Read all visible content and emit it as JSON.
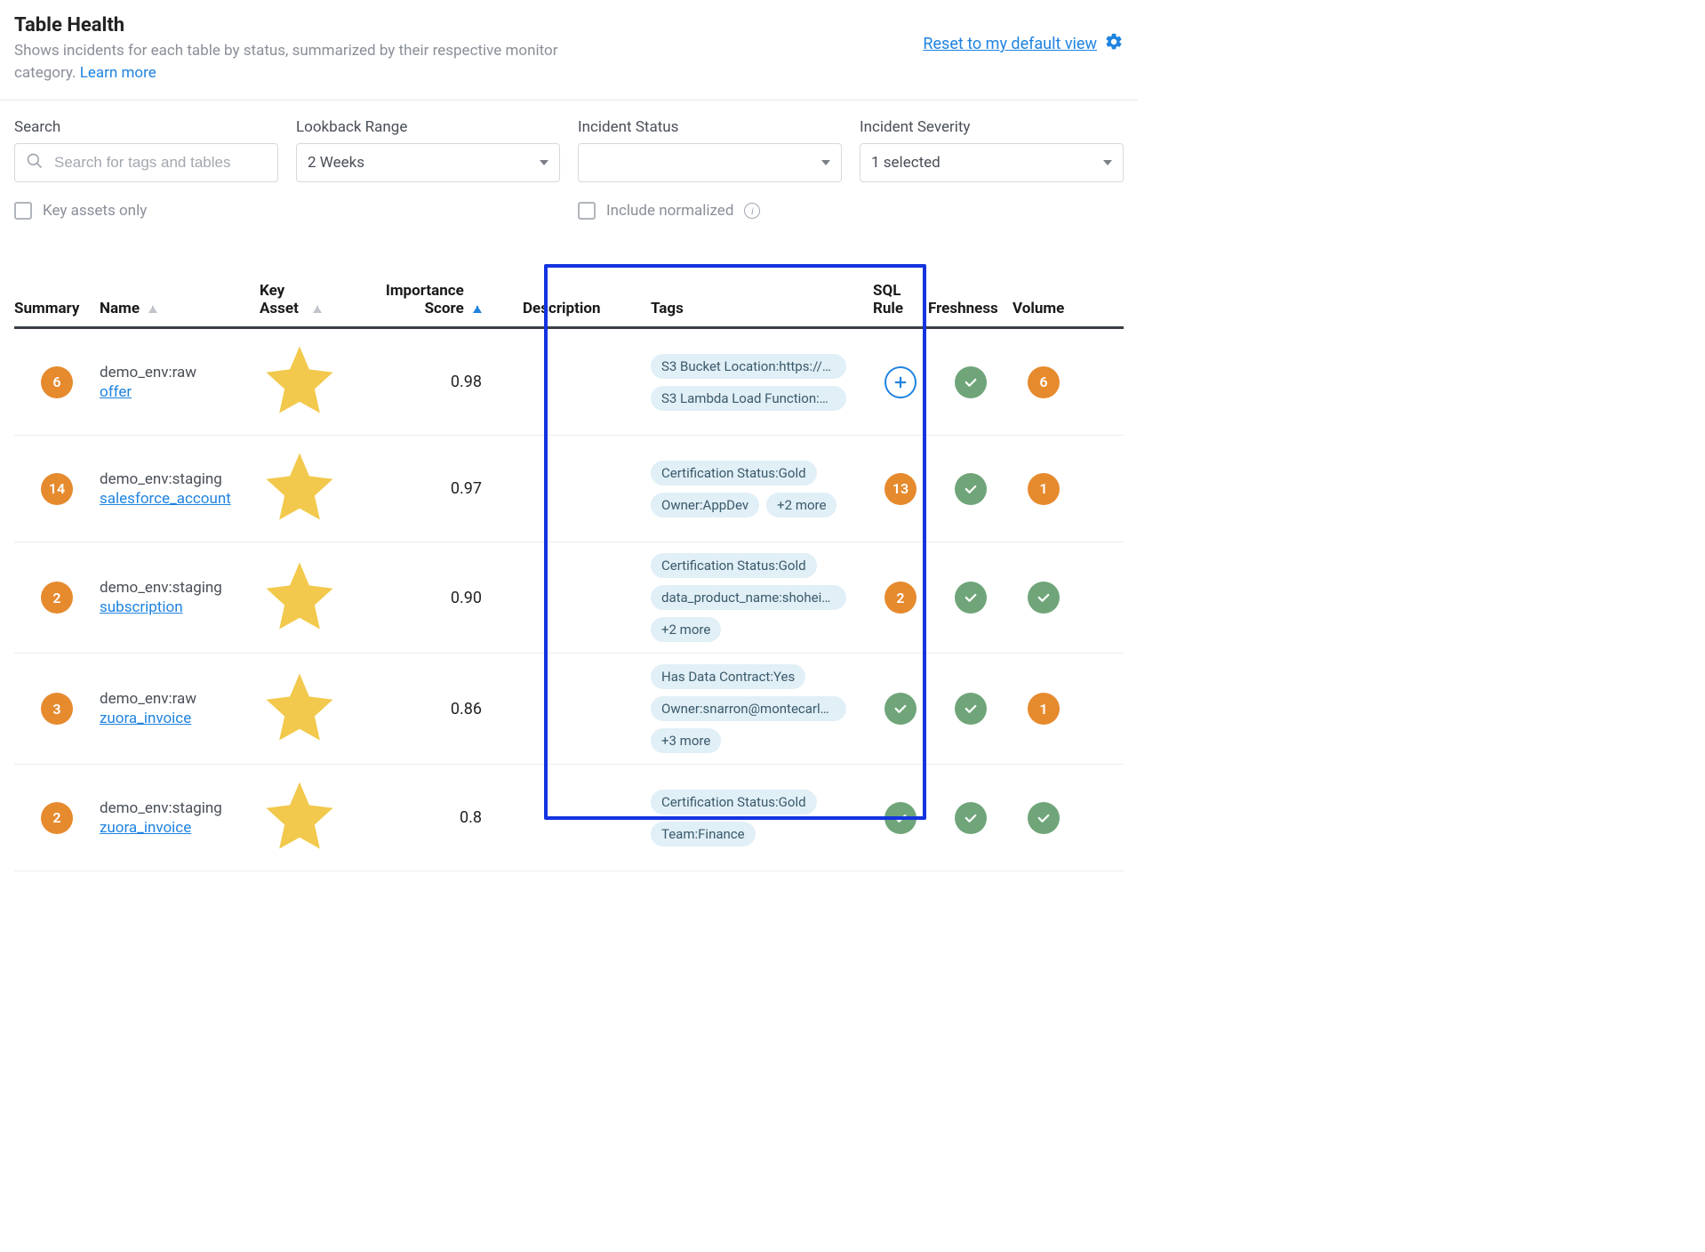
{
  "header": {
    "title": "Table Health",
    "subtitle_pre": "Shows incidents for each table by status, summarized by their respective monitor category. ",
    "learn_more": "Learn more",
    "reset_label": "Reset to my default view"
  },
  "filters": {
    "search": {
      "label": "Search",
      "placeholder": "Search for tags and tables"
    },
    "lookback": {
      "label": "Lookback Range",
      "value": "2 Weeks"
    },
    "status": {
      "label": "Incident Status",
      "value": ""
    },
    "severity": {
      "label": "Incident Severity",
      "value": "1 selected"
    },
    "key_assets_only": "Key assets only",
    "include_normalized": "Include normalized"
  },
  "columns": {
    "summary": "Summary",
    "name": "Name",
    "key_asset": "Key Asset",
    "importance": "Importance Score",
    "description": "Description",
    "tags": "Tags",
    "sql_rule": "SQL Rule",
    "freshness": "Freshness",
    "volume": "Volume"
  },
  "rows": [
    {
      "summary": {
        "type": "orange",
        "value": "6"
      },
      "env": "demo_env:raw",
      "name": "offer",
      "key_asset": true,
      "score": "0.98",
      "tags": [
        "S3 Bucket Location:https://s...",
        "S3 Lambda Load Function:ht..."
      ],
      "sql": {
        "type": "plus",
        "value": ""
      },
      "fresh": {
        "type": "green",
        "value": "check"
      },
      "vol": {
        "type": "orange",
        "value": "6"
      }
    },
    {
      "summary": {
        "type": "orange",
        "value": "14"
      },
      "env": "demo_env:staging",
      "name": "salesforce_account",
      "key_asset": true,
      "score": "0.97",
      "tags": [
        "Certification Status:Gold",
        "Owner:AppDev",
        "+2 more"
      ],
      "sql": {
        "type": "orange",
        "value": "13"
      },
      "fresh": {
        "type": "green",
        "value": "check"
      },
      "vol": {
        "type": "orange",
        "value": "1"
      }
    },
    {
      "summary": {
        "type": "orange",
        "value": "2"
      },
      "env": "demo_env:staging",
      "name": "subscription",
      "key_asset": true,
      "score": "0.90",
      "tags": [
        "Certification Status:Gold",
        "data_product_name:shohei_t...",
        "+2 more"
      ],
      "sql": {
        "type": "orange",
        "value": "2"
      },
      "fresh": {
        "type": "green",
        "value": "check"
      },
      "vol": {
        "type": "green",
        "value": "check"
      }
    },
    {
      "summary": {
        "type": "orange",
        "value": "3"
      },
      "env": "demo_env:raw",
      "name": "zuora_invoice",
      "key_asset": true,
      "score": "0.86",
      "tags": [
        "Has Data Contract:Yes",
        "Owner:snarron@montecarlo...",
        "+3 more"
      ],
      "sql": {
        "type": "green",
        "value": "check"
      },
      "fresh": {
        "type": "green",
        "value": "check"
      },
      "vol": {
        "type": "orange",
        "value": "1"
      }
    },
    {
      "summary": {
        "type": "orange",
        "value": "2"
      },
      "env": "demo_env:staging",
      "name": "zuora_invoice",
      "key_asset": true,
      "score": "0.8",
      "tags": [
        "Certification Status:Gold",
        "Team:Finance"
      ],
      "sql": {
        "type": "green",
        "value": "check"
      },
      "fresh": {
        "type": "green",
        "value": "check"
      },
      "vol": {
        "type": "green",
        "value": "check"
      }
    }
  ]
}
